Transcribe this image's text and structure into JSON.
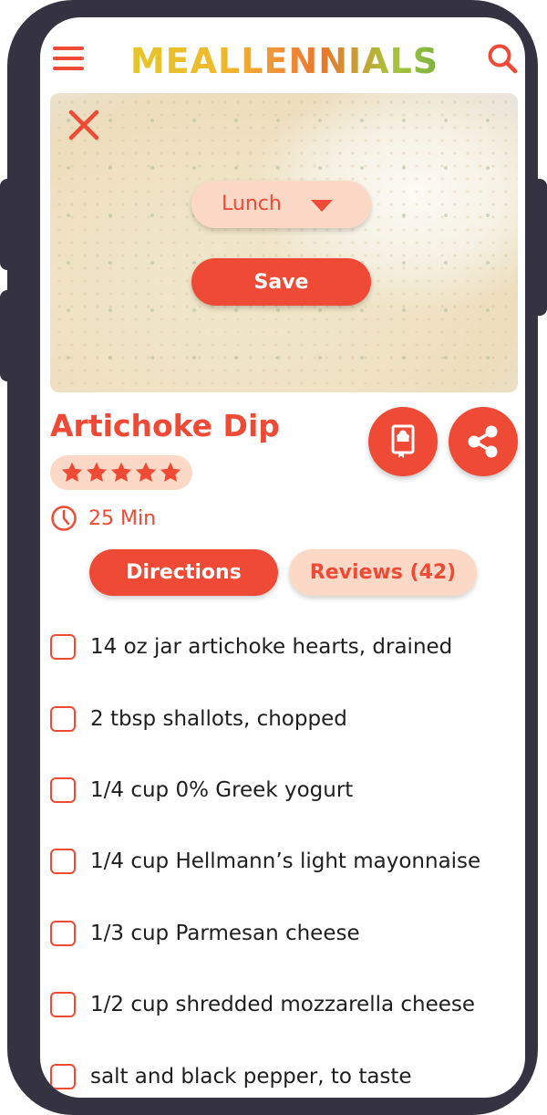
{
  "app": {
    "logo_text": "MEALLENNIALS",
    "brand_color": "#ee4a35",
    "brand_light": "#fcd9c7"
  },
  "header": {
    "menu_icon": "hamburger-menu-icon",
    "search_icon": "search-icon"
  },
  "hero": {
    "close_icon": "close-icon",
    "meal_select": {
      "selected": "Lunch",
      "icon": "caret-down-icon"
    },
    "save_label": "Save"
  },
  "recipe": {
    "title": "Artichoke Dip",
    "rating": 5,
    "rating_max": 5,
    "time": "25 Min",
    "clock_icon": "clock-icon",
    "cookbook_icon": "cookbook-icon",
    "share_icon": "share-icon"
  },
  "tabs": [
    {
      "label": "Directions",
      "active": true
    },
    {
      "label": "Reviews (42)",
      "active": false
    }
  ],
  "ingredients": [
    {
      "text": "14 oz jar artichoke hearts, drained",
      "checked": false
    },
    {
      "text": "2 tbsp shallots, chopped",
      "checked": false
    },
    {
      "text": "1/4 cup 0% Greek yogurt",
      "checked": false
    },
    {
      "text": "1/4 cup Hellmann’s light mayonnaise",
      "checked": false
    },
    {
      "text": "1/3 cup Parmesan cheese",
      "checked": false
    },
    {
      "text": "1/2 cup shredded mozzarella cheese",
      "checked": false
    },
    {
      "text": "salt and black pepper, to taste",
      "checked": false
    }
  ]
}
